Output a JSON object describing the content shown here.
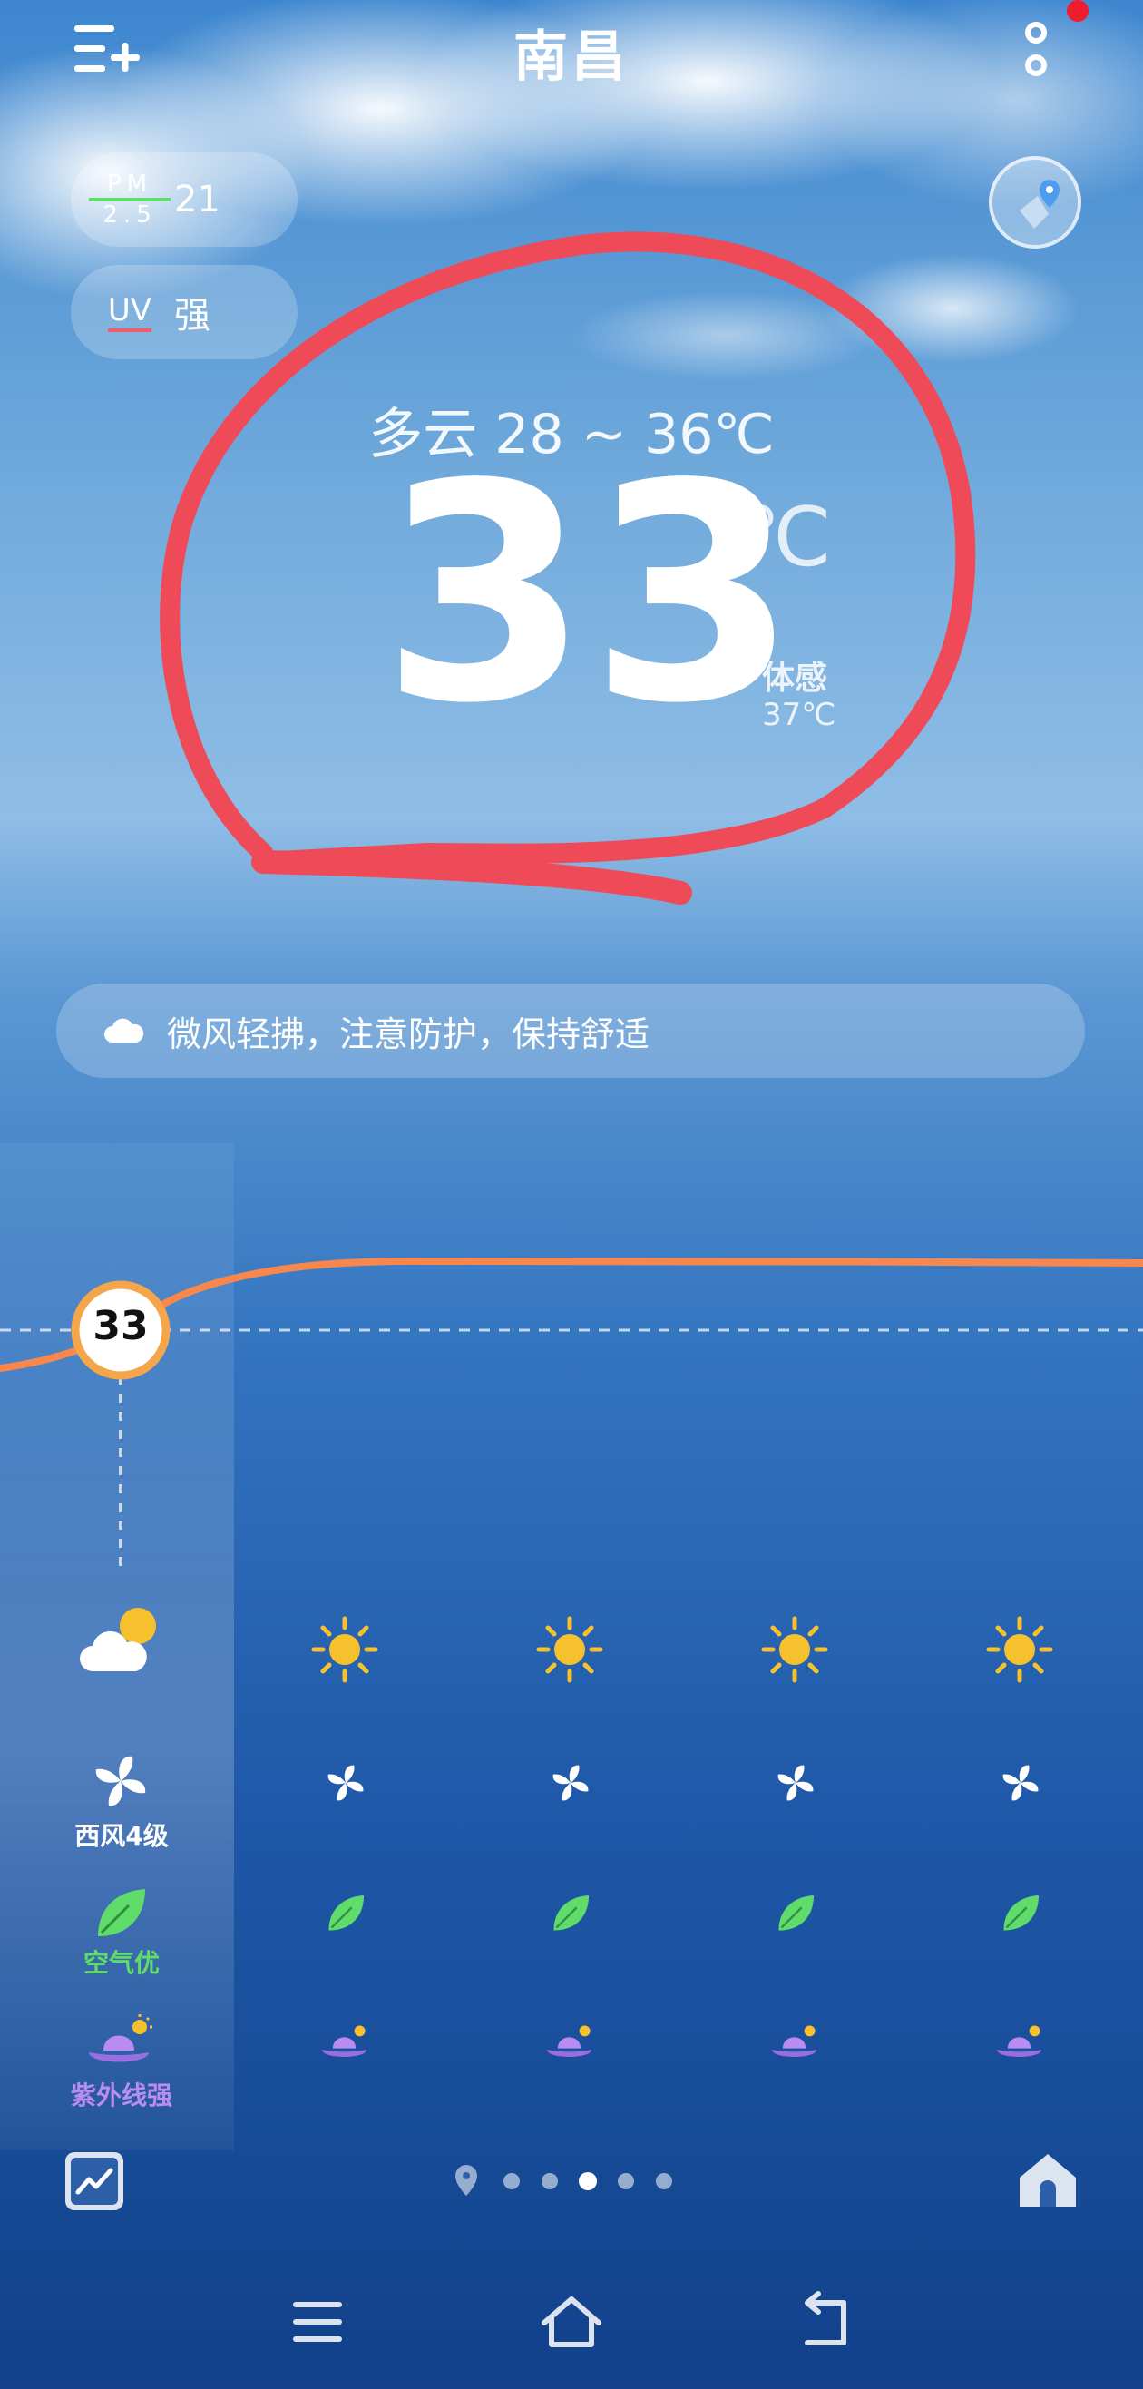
{
  "header": {
    "city": "南昌",
    "add_city_icon": "add-city-icon",
    "menu_icon": "more-vertical-icon"
  },
  "badges": {
    "pm_label_top": "PM",
    "pm_label_bottom": "2.5",
    "pm_value": "21",
    "uv_label": "UV",
    "uv_value": "强"
  },
  "current": {
    "condition_range": "多云  28 ~ 36℃",
    "temperature": "33",
    "unit": "℃",
    "feels_label": "体感",
    "feels_value": "37℃"
  },
  "tip": {
    "text": "微风轻拂，注意防护，保持舒适",
    "icon": "cloud-icon"
  },
  "hourly": {
    "current_temp_marker": "33",
    "first_col": {
      "wind": "西风4级",
      "air": "空气优",
      "uv": "紫外线强"
    },
    "columns": 5,
    "colors": {
      "line": "#f7874d",
      "marker": "#f5a54a",
      "air": "#5fdc6a",
      "uv": "#b88cf0"
    }
  },
  "pager": {
    "dots": 5,
    "active": 2
  }
}
